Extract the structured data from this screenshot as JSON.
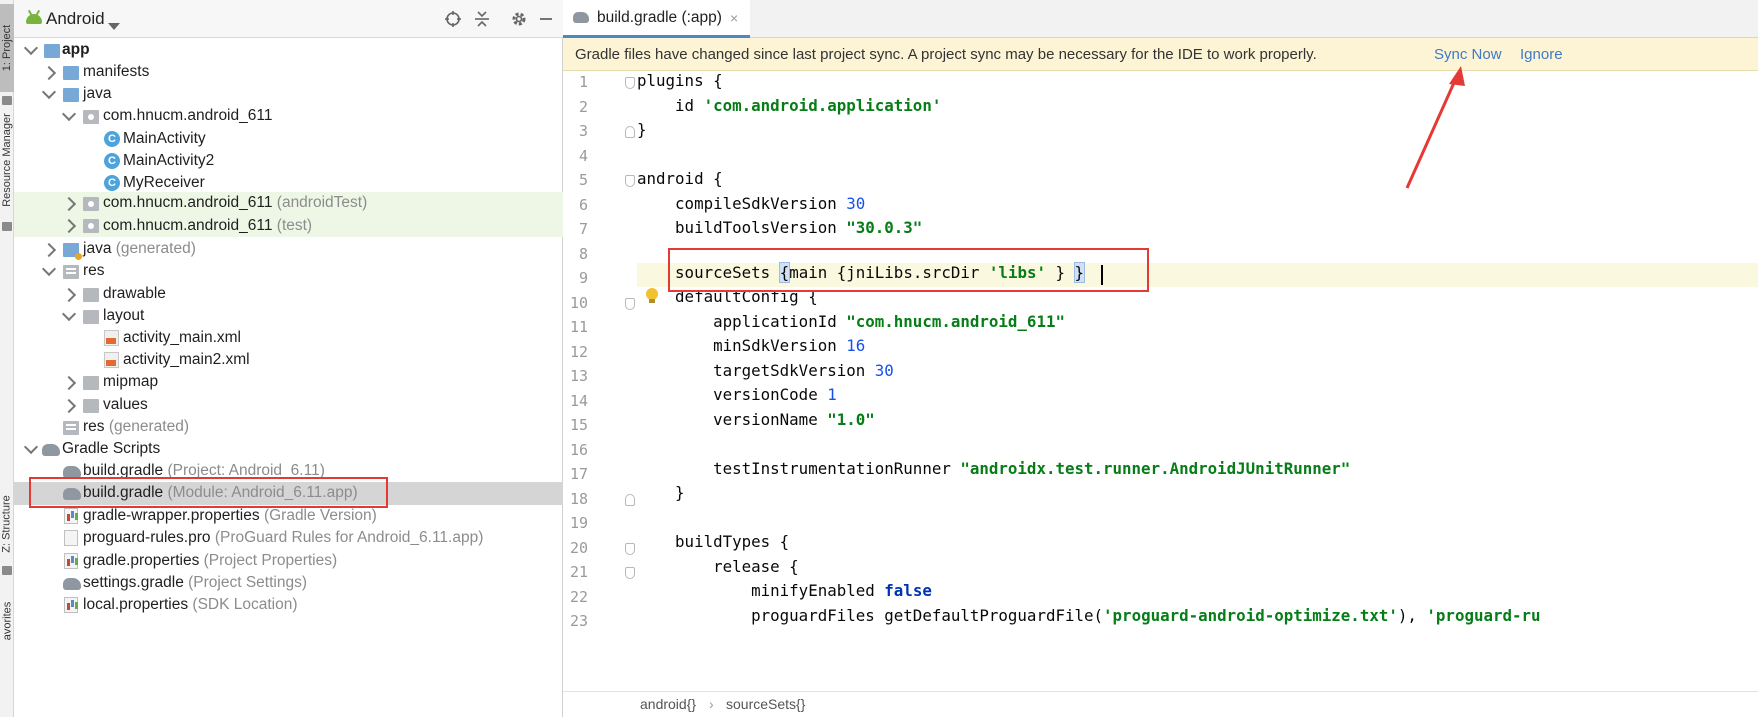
{
  "tool_strip": {
    "project_tab": "1: Project",
    "resource_tab": "Resource Manager",
    "structure_tab": "Z: Structure",
    "favorites_tab": "avorites"
  },
  "project_panel": {
    "view_selector": "Android",
    "header_icons": [
      "crosshair-icon",
      "collapse-icon",
      "gear-icon",
      "minimize-icon"
    ],
    "tree": [
      {
        "name": "app",
        "secondary": ""
      },
      {
        "name": "manifests",
        "secondary": ""
      },
      {
        "name": "java",
        "secondary": ""
      },
      {
        "name": "com.hnucm.android_611",
        "secondary": ""
      },
      {
        "name": "MainActivity",
        "secondary": ""
      },
      {
        "name": "MainActivity2",
        "secondary": ""
      },
      {
        "name": "MyReceiver",
        "secondary": ""
      },
      {
        "name": "com.hnucm.android_611",
        "secondary": "(androidTest)"
      },
      {
        "name": "com.hnucm.android_611",
        "secondary": "(test)"
      },
      {
        "name": "java",
        "secondary": "(generated)"
      },
      {
        "name": "res",
        "secondary": ""
      },
      {
        "name": "drawable",
        "secondary": ""
      },
      {
        "name": "layout",
        "secondary": ""
      },
      {
        "name": "activity_main.xml",
        "secondary": ""
      },
      {
        "name": "activity_main2.xml",
        "secondary": ""
      },
      {
        "name": "mipmap",
        "secondary": ""
      },
      {
        "name": "values",
        "secondary": ""
      },
      {
        "name": "res",
        "secondary": "(generated)"
      },
      {
        "name": "Gradle Scripts",
        "secondary": ""
      },
      {
        "name": "build.gradle",
        "secondary": "(Project: Android_6.11)"
      },
      {
        "name": "build.gradle",
        "secondary": "(Module: Android_6.11.app)"
      },
      {
        "name": "gradle-wrapper.properties",
        "secondary": "(Gradle Version)"
      },
      {
        "name": "proguard-rules.pro",
        "secondary": "(ProGuard Rules for Android_6.11.app)"
      },
      {
        "name": "gradle.properties",
        "secondary": "(Project Properties)"
      },
      {
        "name": "settings.gradle",
        "secondary": "(Project Settings)"
      },
      {
        "name": "local.properties",
        "secondary": "(SDK Location)"
      }
    ]
  },
  "editor": {
    "tab_label": "build.gradle (:app)",
    "tab_close": "×",
    "notification": {
      "message": "Gradle files have changed since last project sync. A project sync may be necessary for the IDE to work properly.",
      "sync_now": "Sync Now",
      "ignore": "Ignore"
    },
    "line_numbers": [
      "1",
      "2",
      "3",
      "4",
      "5",
      "6",
      "7",
      "8",
      "9",
      "10",
      "11",
      "12",
      "13",
      "14",
      "15",
      "16",
      "17",
      "18",
      "19",
      "20",
      "21",
      "22",
      "23"
    ],
    "code": {
      "l1": "plugins {",
      "l2_a": "    id ",
      "l2_b": "'com.android.application'",
      "l3": "}",
      "l5": "android {",
      "l6_a": "    compileSdkVersion ",
      "l6_b": "30",
      "l7_a": "    buildToolsVersion ",
      "l7_b": "\"30.0.3\"",
      "l9_a": "    sourceSets ",
      "l9_b": "{",
      "l9_c": "main {jniLibs.srcDir ",
      "l9_d": "'libs'",
      "l9_e": " } ",
      "l9_f": "}",
      "l10": "    defaultConfig {",
      "l11_a": "        applicationId ",
      "l11_b": "\"com.hnucm.android_611\"",
      "l12_a": "        minSdkVersion ",
      "l12_b": "16",
      "l13_a": "        targetSdkVersion ",
      "l13_b": "30",
      "l14_a": "        versionCode ",
      "l14_b": "1",
      "l15_a": "        versionName ",
      "l15_b": "\"1.0\"",
      "l17_a": "        testInstrumentationRunner ",
      "l17_b": "\"androidx.test.runner.AndroidJUnitRunner\"",
      "l18": "    }",
      "l20": "    buildTypes {",
      "l21": "        release {",
      "l22_a": "            minifyEnabled ",
      "l22_b": "false",
      "l23_a": "            proguardFiles getDefaultProguardFile(",
      "l23_b": "'proguard-android-optimize.txt'",
      "l23_c": "), ",
      "l23_d": "'proguard-ru"
    },
    "breadcrumbs": [
      "android{}",
      "sourceSets{}"
    ],
    "breadcrumb_separator": "›"
  },
  "colors": {
    "string": "#067d17",
    "number": "#1750eb",
    "keyword": "#0033b3",
    "annotation_red": "#e53935",
    "notification_bg": "#fcf4d4",
    "link": "#3d7bc8"
  }
}
